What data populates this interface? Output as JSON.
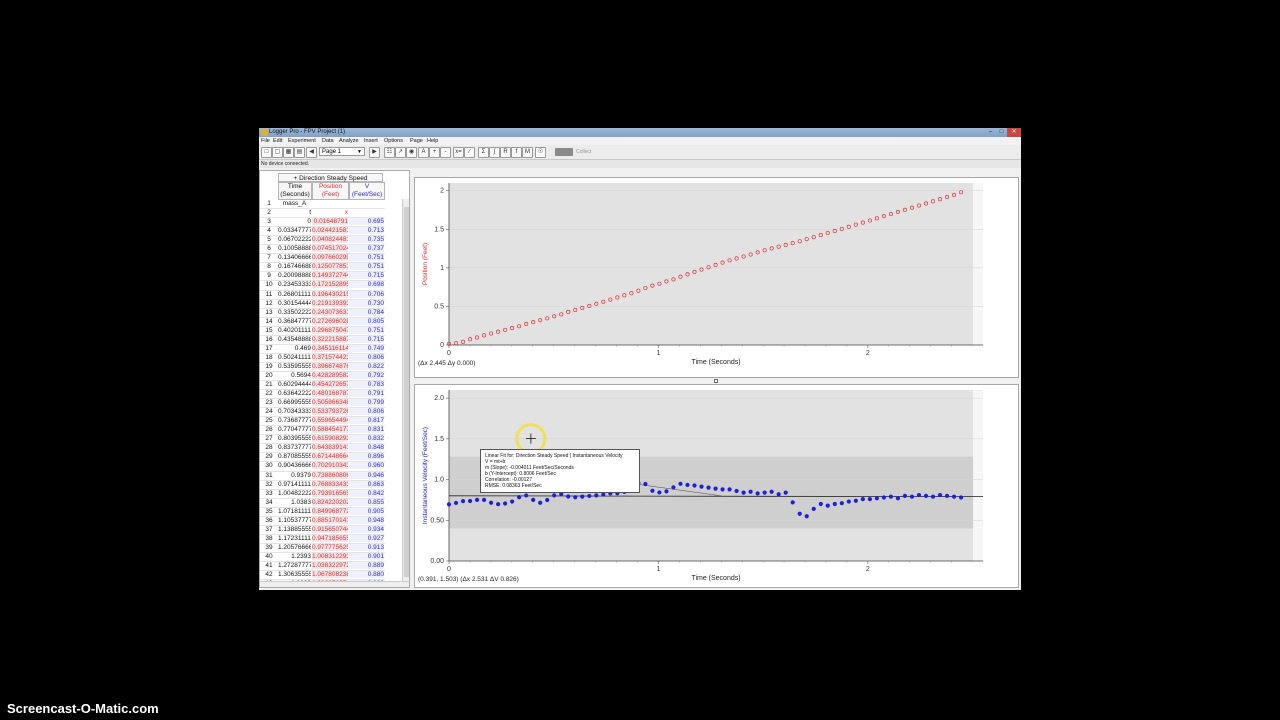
{
  "window": {
    "title": "Logger Pro - FPV Project (1)"
  },
  "menu": [
    "File",
    "Edit",
    "Experiment",
    "Data",
    "Analyze",
    "Insert",
    "Options",
    "Page",
    "Help"
  ],
  "toolbar": {
    "page_value": "Page 1",
    "collect_label": "Collect"
  },
  "status": {
    "message": "No device connected."
  },
  "table": {
    "dataset": "+ Direction Steady Speed",
    "columns": [
      {
        "name": "Time (Seconds)",
        "unit": "t",
        "color": "#111111"
      },
      {
        "name": "Position (Feet)",
        "unit": "x",
        "color": "#e0303a"
      },
      {
        "name": "V (Feet/Sec)",
        "unit": "",
        "color": "#2a2ad8"
      }
    ],
    "label_row": "mass_A",
    "rows": [
      [
        "1",
        "mass_A",
        "",
        ""
      ],
      [
        "2",
        "t",
        "x",
        ""
      ],
      [
        "3",
        "0",
        "0.01648791",
        "0.695"
      ],
      [
        "4",
        "0.033477778",
        "0.024421581",
        "0.713"
      ],
      [
        "5",
        "0.067022222",
        "0.040824481",
        "0.735"
      ],
      [
        "6",
        "0.100588889",
        "0.074517024",
        "0.737"
      ],
      [
        "7",
        "0.134066667",
        "0.097660299",
        "0.751"
      ],
      [
        "8",
        "0.167466889",
        "0.125077851",
        "0.751"
      ],
      [
        "9",
        "0.200988889",
        "0.149372744",
        "0.715"
      ],
      [
        "10",
        "0.234533333",
        "0.172152895",
        "0.698"
      ],
      [
        "11",
        "0.268011111",
        "0.196430215",
        "0.706"
      ],
      [
        "12",
        "0.301544444",
        "0.219139393",
        "0.730"
      ],
      [
        "13",
        "0.335022222",
        "0.243073631",
        "0.784"
      ],
      [
        "14",
        "0.368477778",
        "0.272696028",
        "0.805"
      ],
      [
        "15",
        "0.402011111",
        "0.296875047",
        "0.751"
      ],
      [
        "16",
        "0.435488889",
        "0.322215887",
        "0.715"
      ],
      [
        "17",
        "0.469",
        "0.345116114",
        "0.749"
      ],
      [
        "18",
        "0.502411111",
        "0.371574423",
        "0.806"
      ],
      [
        "19",
        "0.535955556",
        "0.396674876",
        "0.822"
      ],
      [
        "20",
        "0.5694",
        "0.428289582",
        "0.792"
      ],
      [
        "21",
        "0.602944444",
        "0.454272657",
        "0.783"
      ],
      [
        "22",
        "0.636422222",
        "0.480168787",
        "0.791"
      ],
      [
        "23",
        "0.669955556",
        "0.505866348",
        "0.799"
      ],
      [
        "24",
        "0.703433333",
        "0.533793726",
        "0.806"
      ],
      [
        "25",
        "0.736877778",
        "0.559654494",
        "0.817"
      ],
      [
        "26",
        "0.770477778",
        "0.588454177",
        "0.831"
      ],
      [
        "27",
        "0.803955556",
        "0.615908293",
        "0.832"
      ],
      [
        "28",
        "0.837377778",
        "0.643839141",
        "0.848"
      ],
      [
        "29",
        "0.870855556",
        "0.671448664",
        "0.896"
      ],
      [
        "30",
        "0.904366667",
        "0.702910343",
        "0.960"
      ],
      [
        "31",
        "0.9379",
        "0.738860806",
        "0.946"
      ],
      [
        "32",
        "0.971411111",
        "0.768833433",
        "0.863"
      ],
      [
        "33",
        "1.004822222",
        "0.793916565",
        "0.842"
      ],
      [
        "34",
        "1.0383",
        "0.824220202",
        "0.855"
      ],
      [
        "35",
        "1.071811111",
        "0.849968772",
        "0.905"
      ],
      [
        "36",
        "1.105377778",
        "0.885170141",
        "0.948"
      ],
      [
        "37",
        "1.138855556",
        "0.915650744",
        "0.934"
      ],
      [
        "38",
        "1.172311111",
        "0.947185655",
        "0.927"
      ],
      [
        "39",
        "1.205766667",
        "0.977775625",
        "0.913"
      ],
      [
        "40",
        "1.2393",
        "1.008312293",
        "0.901"
      ],
      [
        "41",
        "1.272877778",
        "1.038322972",
        "0.889"
      ],
      [
        "42",
        "1.306355556",
        "1.067808238",
        "0.880"
      ],
      [
        "43",
        "1.3398",
        "1.096676554",
        "0.880"
      ]
    ]
  },
  "graph1": {
    "ylabel": "Position (Feet)",
    "xlabel": "Time (Seconds)",
    "y_ticks": [
      "0",
      "0.5",
      "1",
      "1.5",
      "2"
    ],
    "x_ticks": [
      "0",
      "1",
      "2"
    ],
    "readout": "(Δx 2.445  Δy 0.000)",
    "color": "#e0303a"
  },
  "graph2": {
    "ylabel": "Instantaneous Velocity (Feet/Sec)",
    "xlabel": "Time (Seconds)",
    "y_ticks": [
      "0.00",
      "0.50",
      "1.0",
      "1.5",
      "2.0"
    ],
    "x_ticks": [
      "0",
      "1",
      "2"
    ],
    "readout": "(0.391, 1.503)  (Δx 2.531  ΔV 0.826)",
    "color": "#1f1fd6"
  },
  "fit_box": {
    "lines": [
      "Linear Fit for: Direction Steady Speed | Instantaneous Velocity",
      "V = mt+b",
      "m (Slope): -0.004011 Feet/Sec/Seconds",
      "b (Y-Intercept): 0.8006 Feet/Sec",
      "Correlation: -0.00127",
      "RMSE: 0.08363 Feet/Sec"
    ]
  },
  "chart_data": [
    {
      "type": "scatter",
      "ylabel": "Position (Feet)",
      "xlabel": "Time (Seconds)",
      "xlim": [
        0,
        2.55
      ],
      "ylim": [
        0,
        2.1
      ],
      "x": [
        0,
        0.0335,
        0.067,
        0.1006,
        0.1341,
        0.1675,
        0.201,
        0.2345,
        0.268,
        0.3015,
        0.335,
        0.3685,
        0.402,
        0.4355,
        0.469,
        0.5024,
        0.536,
        0.5694,
        0.6029,
        0.6364,
        0.67,
        0.7034,
        0.7369,
        0.7705,
        0.804,
        0.8374,
        0.8709,
        0.9044,
        0.9379,
        0.9714,
        1.0048,
        1.0383,
        1.0718,
        1.1054,
        1.1389,
        1.1723,
        1.2058,
        1.2393,
        1.2729,
        1.3064,
        1.3398,
        1.3733,
        1.4068,
        1.4403,
        1.4738,
        1.5073,
        1.5408,
        1.5743,
        1.6078,
        1.6413,
        1.6748,
        1.7083,
        1.7418,
        1.7753,
        1.8088,
        1.8423,
        1.8758,
        1.9093,
        1.9428,
        1.9763,
        2.0098,
        2.0433,
        2.0768,
        2.1103,
        2.1438,
        2.1773,
        2.2108,
        2.2443,
        2.2778,
        2.3113,
        2.3448,
        2.3783,
        2.4118,
        2.4453
      ],
      "y": [
        0.016,
        0.024,
        0.041,
        0.075,
        0.098,
        0.125,
        0.149,
        0.172,
        0.196,
        0.219,
        0.243,
        0.273,
        0.297,
        0.322,
        0.345,
        0.372,
        0.397,
        0.428,
        0.454,
        0.48,
        0.506,
        0.534,
        0.56,
        0.588,
        0.616,
        0.644,
        0.671,
        0.703,
        0.739,
        0.769,
        0.794,
        0.824,
        0.85,
        0.885,
        0.916,
        0.947,
        0.978,
        1.008,
        1.038,
        1.068,
        1.097,
        1.122,
        1.147,
        1.173,
        1.2,
        1.228,
        1.252,
        1.275,
        1.297,
        1.32,
        1.345,
        1.372,
        1.398,
        1.425,
        1.452,
        1.478,
        1.505,
        1.532,
        1.56,
        1.587,
        1.614,
        1.642,
        1.67,
        1.697,
        1.725,
        1.752,
        1.78,
        1.808,
        1.835,
        1.862,
        1.89,
        1.918,
        1.945,
        1.98
      ]
    },
    {
      "type": "scatter",
      "ylabel": "Instantaneous Velocity (Feet/Sec)",
      "xlabel": "Time (Seconds)",
      "xlim": [
        0,
        2.55
      ],
      "ylim": [
        0,
        2.1
      ],
      "fit": {
        "slope": -0.004011,
        "intercept": 0.8006
      },
      "x": [
        0,
        0.0335,
        0.067,
        0.1006,
        0.1341,
        0.1675,
        0.201,
        0.2345,
        0.268,
        0.3015,
        0.335,
        0.3685,
        0.402,
        0.4355,
        0.469,
        0.5024,
        0.536,
        0.5694,
        0.6029,
        0.6364,
        0.67,
        0.7034,
        0.7369,
        0.7705,
        0.804,
        0.8374,
        0.8709,
        0.9044,
        0.9379,
        0.9714,
        1.0048,
        1.0383,
        1.0718,
        1.1054,
        1.1389,
        1.1723,
        1.2058,
        1.2393,
        1.2729,
        1.3064,
        1.3398,
        1.3733,
        1.4068,
        1.4403,
        1.4738,
        1.5073,
        1.5408,
        1.5743,
        1.6078,
        1.6413,
        1.6748,
        1.7083,
        1.7418,
        1.7753,
        1.8088,
        1.8423,
        1.8758,
        1.9093,
        1.9428,
        1.9763,
        2.0098,
        2.0433,
        2.0768,
        2.1103,
        2.1438,
        2.1773,
        2.2108,
        2.2443,
        2.2778,
        2.3113,
        2.3448,
        2.3783,
        2.4118,
        2.4453
      ],
      "y": [
        0.695,
        0.713,
        0.735,
        0.737,
        0.751,
        0.751,
        0.715,
        0.698,
        0.706,
        0.73,
        0.784,
        0.805,
        0.751,
        0.715,
        0.749,
        0.806,
        0.822,
        0.792,
        0.783,
        0.791,
        0.799,
        0.806,
        0.817,
        0.831,
        0.832,
        0.848,
        0.896,
        0.96,
        0.946,
        0.863,
        0.842,
        0.855,
        0.905,
        0.948,
        0.934,
        0.927,
        0.913,
        0.901,
        0.889,
        0.88,
        0.88,
        0.86,
        0.84,
        0.85,
        0.83,
        0.84,
        0.85,
        0.82,
        0.84,
        0.72,
        0.58,
        0.55,
        0.64,
        0.7,
        0.68,
        0.7,
        0.71,
        0.73,
        0.74,
        0.76,
        0.76,
        0.77,
        0.78,
        0.79,
        0.77,
        0.8,
        0.79,
        0.81,
        0.8,
        0.79,
        0.81,
        0.8,
        0.79,
        0.78
      ]
    }
  ],
  "watermark": "Screencast-O-Matic.com"
}
